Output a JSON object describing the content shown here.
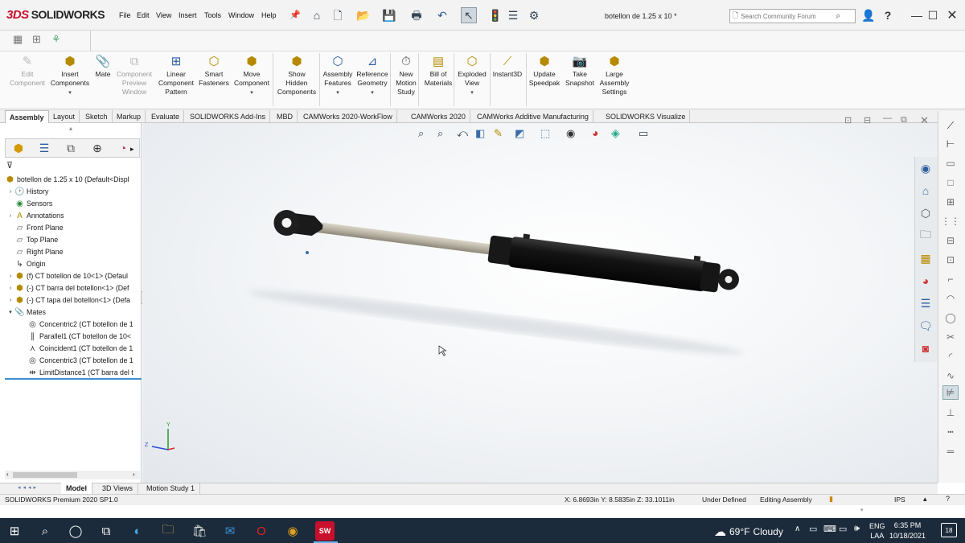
{
  "app": {
    "brand_ds": "3DS",
    "brand_name": "SOLIDWORKS"
  },
  "menu": [
    "File",
    "Edit",
    "View",
    "Insert",
    "Tools",
    "Window",
    "Help"
  ],
  "document_title": "botellon de 1.25 x 10 *",
  "search": {
    "placeholder": "Search Community Forum"
  },
  "commands": [
    {
      "label": "Edit\nComponent",
      "icon": "edit-component-icon",
      "enabled": false
    },
    {
      "label": "Insert\nComponents",
      "icon": "insert-components-icon",
      "enabled": true
    },
    {
      "label": "Mate",
      "icon": "mate-icon",
      "enabled": true
    },
    {
      "label": "Component\nPreview\nWindow",
      "icon": "preview-window-icon",
      "enabled": false
    },
    {
      "label": "Linear\nComponent\nPattern",
      "icon": "linear-pattern-icon",
      "enabled": true
    },
    {
      "label": "Smart\nFasteners",
      "icon": "smart-fasteners-icon",
      "enabled": true
    },
    {
      "label": "Move\nComponent",
      "icon": "move-component-icon",
      "enabled": true
    },
    {
      "label": "Show\nHidden\nComponents",
      "icon": "show-hidden-icon",
      "enabled": true
    },
    {
      "label": "Assembly\nFeatures",
      "icon": "assembly-features-icon",
      "enabled": true
    },
    {
      "label": "Reference\nGeometry",
      "icon": "reference-geometry-icon",
      "enabled": true
    },
    {
      "label": "New\nMotion\nStudy",
      "icon": "motion-study-icon",
      "enabled": true
    },
    {
      "label": "Bill of\nMaterials",
      "icon": "bom-icon",
      "enabled": true
    },
    {
      "label": "Exploded\nView",
      "icon": "exploded-view-icon",
      "enabled": true
    },
    {
      "label": "Instant3D",
      "icon": "instant3d-icon",
      "enabled": true
    },
    {
      "label": "Update\nSpeedpak",
      "icon": "speedpak-icon",
      "enabled": true
    },
    {
      "label": "Take\nSnapshot",
      "icon": "snapshot-icon",
      "enabled": true
    },
    {
      "label": "Large\nAssembly\nSettings",
      "icon": "large-assembly-icon",
      "enabled": true
    }
  ],
  "tabs": [
    "Assembly",
    "Layout",
    "Sketch",
    "Markup",
    "Evaluate",
    "SOLIDWORKS Add-Ins",
    "MBD",
    "CAMWorks 2020-WorkFlow",
    "CAMWorks 2020",
    "CAMWorks Additive Manufacturing",
    "SOLIDWORKS Visualize"
  ],
  "active_tab": "Assembly",
  "tree": [
    {
      "label": "botellon de 1.25 x 10  (Default<Displ",
      "icon": "assembly-icon",
      "indent": 0,
      "expander": false
    },
    {
      "label": "History",
      "icon": "history-icon",
      "indent": 1,
      "expander": true
    },
    {
      "label": "Sensors",
      "icon": "sensors-icon",
      "indent": 1,
      "expander": false
    },
    {
      "label": "Annotations",
      "icon": "annotations-icon",
      "indent": 1,
      "expander": true
    },
    {
      "label": "Front Plane",
      "icon": "plane-icon",
      "indent": 1,
      "expander": false
    },
    {
      "label": "Top Plane",
      "icon": "plane-icon",
      "indent": 1,
      "expander": false
    },
    {
      "label": "Right Plane",
      "icon": "plane-icon",
      "indent": 1,
      "expander": false
    },
    {
      "label": "Origin",
      "icon": "origin-icon",
      "indent": 1,
      "expander": false
    },
    {
      "label": "(f) CT botellon de 10<1> (Defaul",
      "icon": "part-icon",
      "indent": 1,
      "expander": true
    },
    {
      "label": "(-) CT barra del botellon<1> (Def",
      "icon": "part-icon",
      "indent": 1,
      "expander": true
    },
    {
      "label": "(-) CT tapa del botellon<1> (Defa",
      "icon": "part-icon",
      "indent": 1,
      "expander": true
    },
    {
      "label": "Mates",
      "icon": "mates-icon",
      "indent": 1,
      "expander": true
    },
    {
      "label": "Concentric2 (CT botellon de 1",
      "icon": "concentric-mate-icon",
      "indent": 2,
      "expander": false
    },
    {
      "label": "Parallel1 (CT botellon de 10<",
      "icon": "parallel-mate-icon",
      "indent": 2,
      "expander": false
    },
    {
      "label": "Coincident1 (CT botellon de 1",
      "icon": "coincident-mate-icon",
      "indent": 2,
      "expander": false
    },
    {
      "label": "Concentric3 (CT botellon de 1",
      "icon": "concentric-mate-icon",
      "indent": 2,
      "expander": false
    },
    {
      "label": "LimitDistance1 (CT barra del t",
      "icon": "limit-distance-icon",
      "indent": 2,
      "expander": false
    }
  ],
  "bottom_tabs": [
    "Model",
    "3D Views",
    "Motion Study 1"
  ],
  "active_bottom_tab": "Model",
  "status": {
    "version": "SOLIDWORKS Premium 2020 SP1.0",
    "coords": "X: 6.8693in Y: 8.5835in Z: 33.1011in",
    "state": "Under Defined",
    "mode": "Editing Assembly",
    "units": "IPS"
  },
  "taskbar": {
    "weather_temp": "69°F",
    "weather_text": "Cloudy",
    "lang_line1": "ENG",
    "lang_line2": "LAA",
    "time": "6:35 PM",
    "date": "10/18/2021",
    "notifications": "18",
    "sw_badge": "SW"
  },
  "colors": {
    "accent": "#3a8fd0",
    "brand": "#c8102e",
    "taskbar": "#1c2b3b",
    "cylinder": "#111111",
    "rod": "#b8b3a4"
  }
}
